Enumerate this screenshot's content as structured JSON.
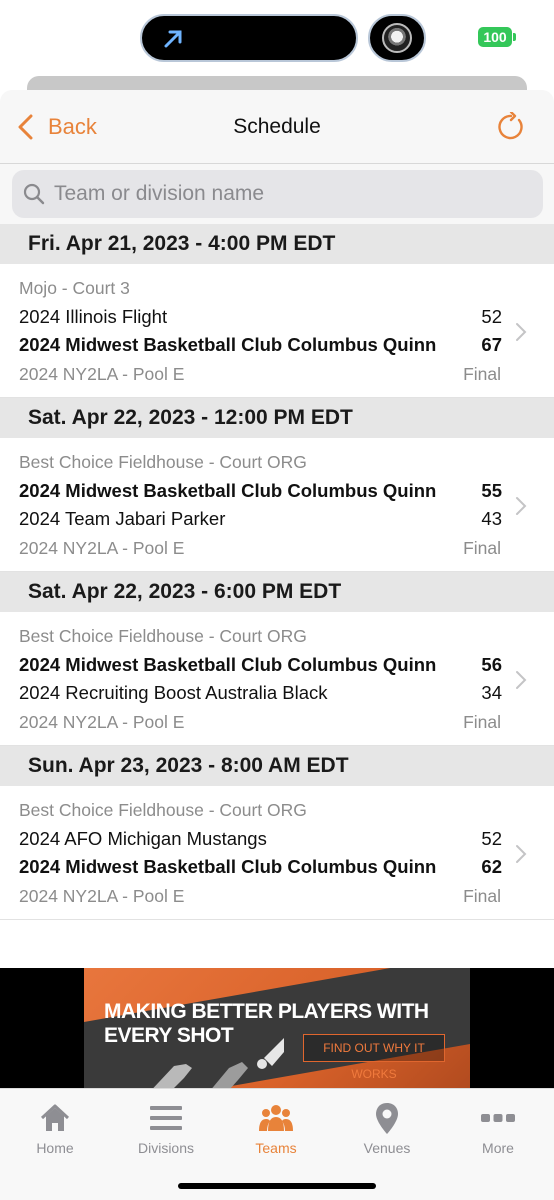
{
  "status_bar": {
    "battery": "100",
    "battery_color": "#34c759"
  },
  "nav": {
    "back_label": "Back",
    "title": "Schedule",
    "accent_color": "#e8833a",
    "icons": [
      "chevron-left-icon",
      "refresh-icon"
    ]
  },
  "search": {
    "placeholder": "Team or division name",
    "value": ""
  },
  "days": [
    {
      "header": "Fri. Apr 21, 2023 - 4:00 PM EDT",
      "game": {
        "venue": "Mojo - Court 3",
        "team1": "2024 Illinois Flight",
        "score1": "52",
        "team1_bold": false,
        "team2": "2024 Midwest Basketball Club Columbus Quinn",
        "score2": "67",
        "team2_bold": true,
        "pool": "2024 NY2LA - Pool E",
        "status": "Final"
      }
    },
    {
      "header": "Sat. Apr 22, 2023 - 12:00 PM EDT",
      "game": {
        "venue": "Best Choice Fieldhouse - Court ORG",
        "team1": "2024 Midwest Basketball Club Columbus Quinn",
        "score1": "55",
        "team1_bold": true,
        "team2": "2024 Team Jabari Parker",
        "score2": "43",
        "team2_bold": false,
        "pool": "2024 NY2LA - Pool E",
        "status": "Final"
      }
    },
    {
      "header": "Sat. Apr 22, 2023 - 6:00 PM EDT",
      "game": {
        "venue": "Best Choice Fieldhouse - Court ORG",
        "team1": "2024 Midwest Basketball Club Columbus Quinn",
        "score1": "56",
        "team1_bold": true,
        "team2": "2024 Recruiting Boost Australia Black",
        "score2": "34",
        "team2_bold": false,
        "pool": "2024 NY2LA - Pool E",
        "status": "Final"
      }
    },
    {
      "header": "Sun. Apr 23, 2023 - 8:00 AM EDT",
      "game": {
        "venue": "Best Choice Fieldhouse - Court ORG",
        "team1": "2024 AFO Michigan Mustangs",
        "score1": "52",
        "team1_bold": false,
        "team2": "2024 Midwest Basketball Club Columbus Quinn",
        "score2": "62",
        "team2_bold": true,
        "pool": "2024 NY2LA - Pool E",
        "status": "Final"
      }
    }
  ],
  "ad": {
    "headline": "MAKING BETTER PLAYERS WITH EVERY SHOT",
    "cta": "FIND OUT WHY IT WORKS"
  },
  "tabs": [
    {
      "label": "Home",
      "icon": "home-icon",
      "active": false
    },
    {
      "label": "Divisions",
      "icon": "list-icon",
      "active": false
    },
    {
      "label": "Teams",
      "icon": "people-icon",
      "active": true
    },
    {
      "label": "Venues",
      "icon": "map-pin-icon",
      "active": false
    },
    {
      "label": "More",
      "icon": "more-icon",
      "active": false
    }
  ]
}
